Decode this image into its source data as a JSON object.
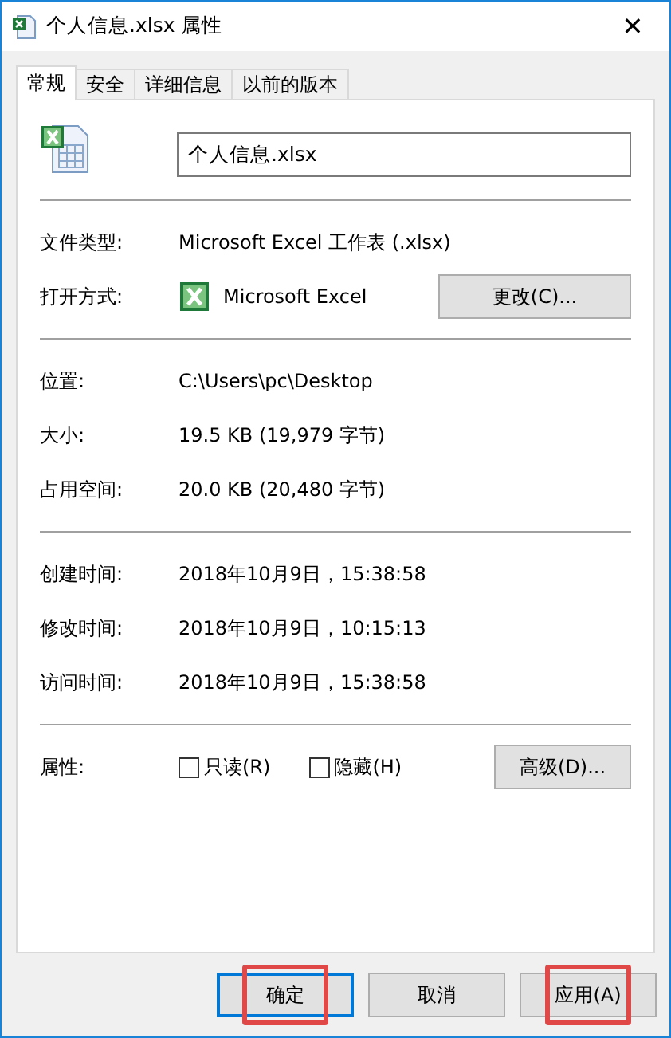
{
  "window": {
    "title": "个人信息.xlsx 属性",
    "close": "✕"
  },
  "tabs": [
    {
      "label": "常规",
      "selected": true
    },
    {
      "label": "安全",
      "selected": false
    },
    {
      "label": "详细信息",
      "selected": false
    },
    {
      "label": "以前的版本",
      "selected": false
    }
  ],
  "file_name": {
    "value": "个人信息.xlsx"
  },
  "type_section": [
    {
      "label": "文件类型:",
      "value": "Microsoft Excel 工作表 (.xlsx)"
    },
    {
      "label": "打开方式:",
      "value": "Microsoft Excel",
      "button": "更改(C)..."
    }
  ],
  "location_section": [
    {
      "label": "位置:",
      "value": "C:\\Users\\pc\\Desktop"
    },
    {
      "label": "大小:",
      "value": "19.5 KB (19,979 字节)"
    },
    {
      "label": "占用空间:",
      "value": "20.0 KB (20,480 字节)"
    }
  ],
  "time_section": [
    {
      "label": "创建时间:",
      "value": "2018年10月9日，15:38:58"
    },
    {
      "label": "修改时间:",
      "value": "2018年10月9日，10:15:13"
    },
    {
      "label": "访问时间:",
      "value": "2018年10月9日，15:38:58"
    }
  ],
  "attributes": {
    "label": "属性:",
    "checkboxes": [
      {
        "label": "只读(R)",
        "checked": false
      },
      {
        "label": "隐藏(H)",
        "checked": false
      }
    ],
    "button": "高级(D)..."
  },
  "footer_buttons": [
    {
      "label": "确定",
      "default": true,
      "highlighted": true
    },
    {
      "label": "取消",
      "default": false,
      "highlighted": false
    },
    {
      "label": "应用(A)",
      "default": false,
      "highlighted": true
    }
  ]
}
